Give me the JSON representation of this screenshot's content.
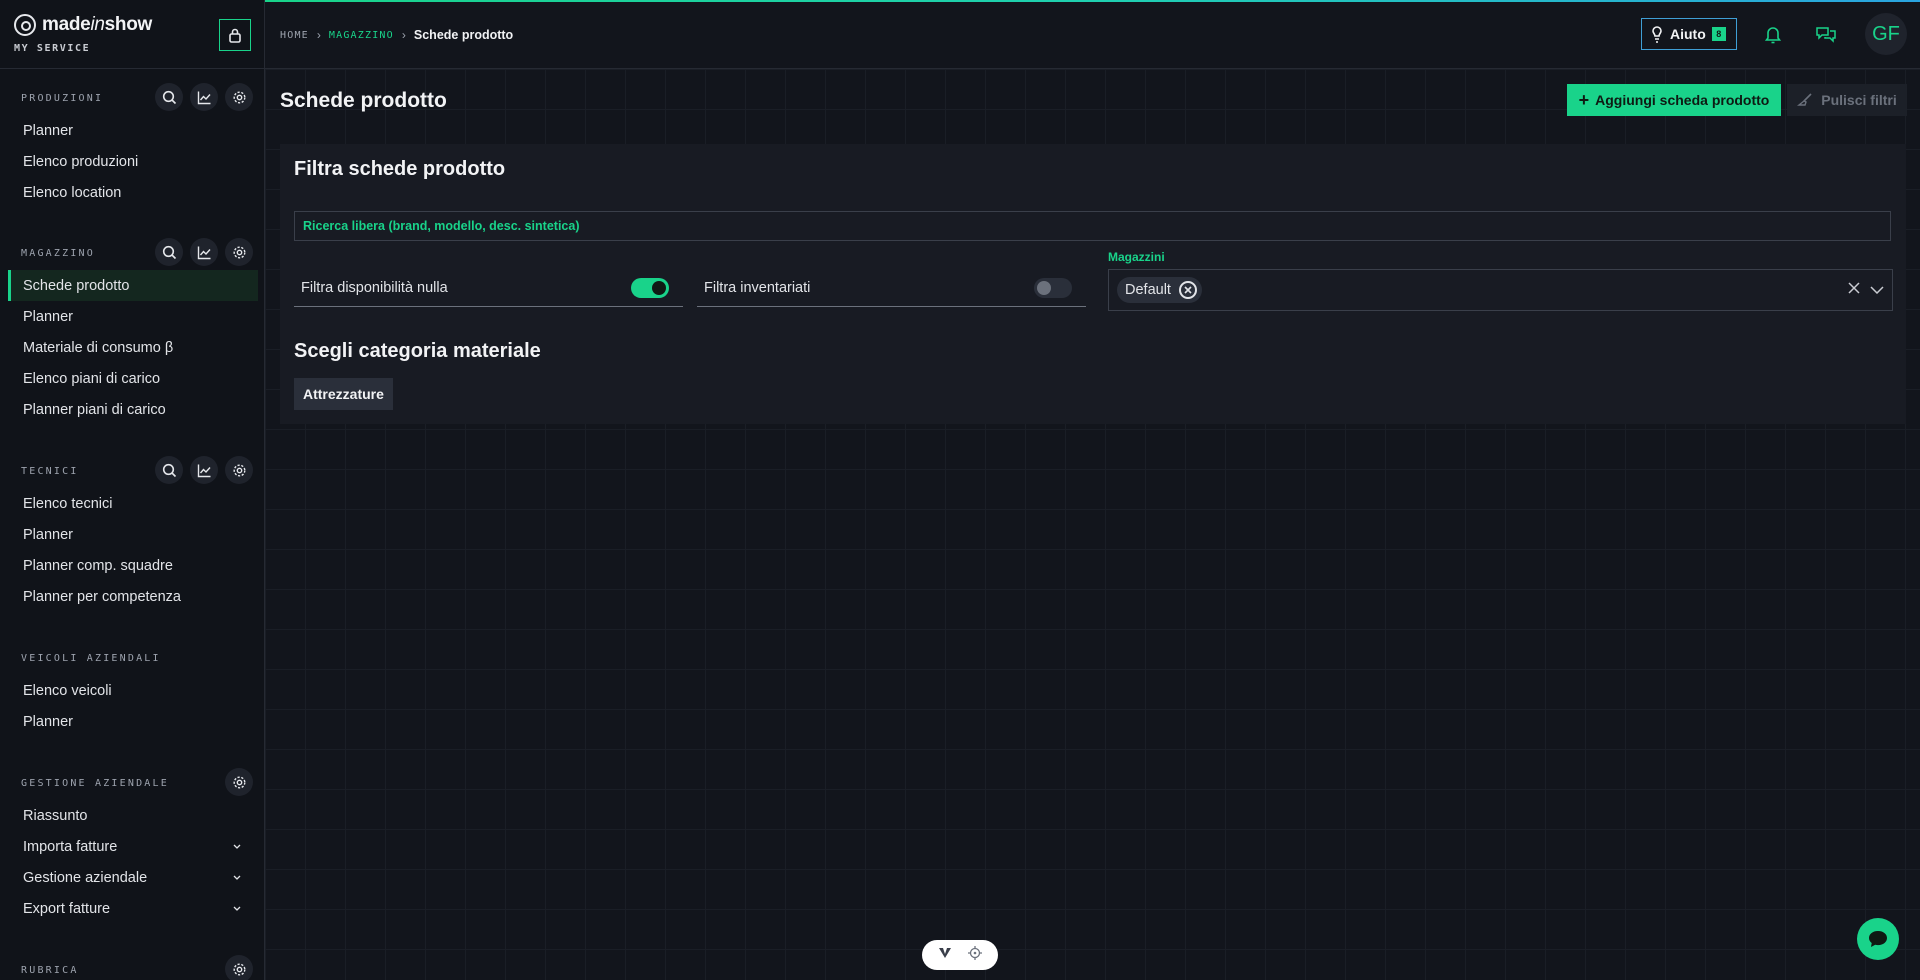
{
  "brand": {
    "name_pre": "made",
    "name_italic": "in",
    "name_post": "show",
    "subtitle": "MY SERVICE"
  },
  "sidebar": {
    "sections": [
      {
        "title": "PRODUZIONI",
        "items": [
          "Planner",
          "Elenco produzioni",
          "Elenco location"
        ]
      },
      {
        "title": "MAGAZZINO",
        "items": [
          "Schede prodotto",
          "Planner",
          "Materiale di consumo β",
          "Elenco piani di carico",
          "Planner piani di carico"
        ],
        "active_index": 0
      },
      {
        "title": "TECNICI",
        "items": [
          "Elenco tecnici",
          "Planner",
          "Planner comp. squadre",
          "Planner per competenza"
        ]
      },
      {
        "title": "VEICOLI AZIENDALI",
        "items": [
          "Elenco veicoli",
          "Planner"
        ]
      },
      {
        "title": "GESTIONE AZIENDALE",
        "items": [
          "Riassunto",
          "Importa fatture",
          "Gestione aziendale",
          "Export fatture"
        ]
      },
      {
        "title": "RUBRICA",
        "items": []
      }
    ]
  },
  "header": {
    "breadcrumb": {
      "home": "HOME",
      "section": "MAGAZZINO",
      "current": "Schede prodotto"
    },
    "help_label": "Aiuto",
    "help_badge": "8",
    "avatar_initials": "GF"
  },
  "page": {
    "title": "Schede prodotto",
    "add_button": "Aggiungi scheda prodotto",
    "clear_button": "Pulisci filtri"
  },
  "filters": {
    "title": "Filtra schede prodotto",
    "search_placeholder": "Ricerca libera (brand, modello, desc. sintetica)",
    "toggle_null_label": "Filtra disponibilità nulla",
    "toggle_null_on": true,
    "toggle_inventory_label": "Filtra inventariati",
    "toggle_inventory_on": false,
    "warehouses_label": "Magazzini",
    "warehouse_chip": "Default"
  },
  "categories": {
    "title": "Scegli categoria materiale",
    "items": [
      "Attrezzature"
    ]
  },
  "colors": {
    "accent": "#19d38a",
    "help_border": "#3f9fd6",
    "background": "#12151c",
    "panel": "#181b23"
  }
}
